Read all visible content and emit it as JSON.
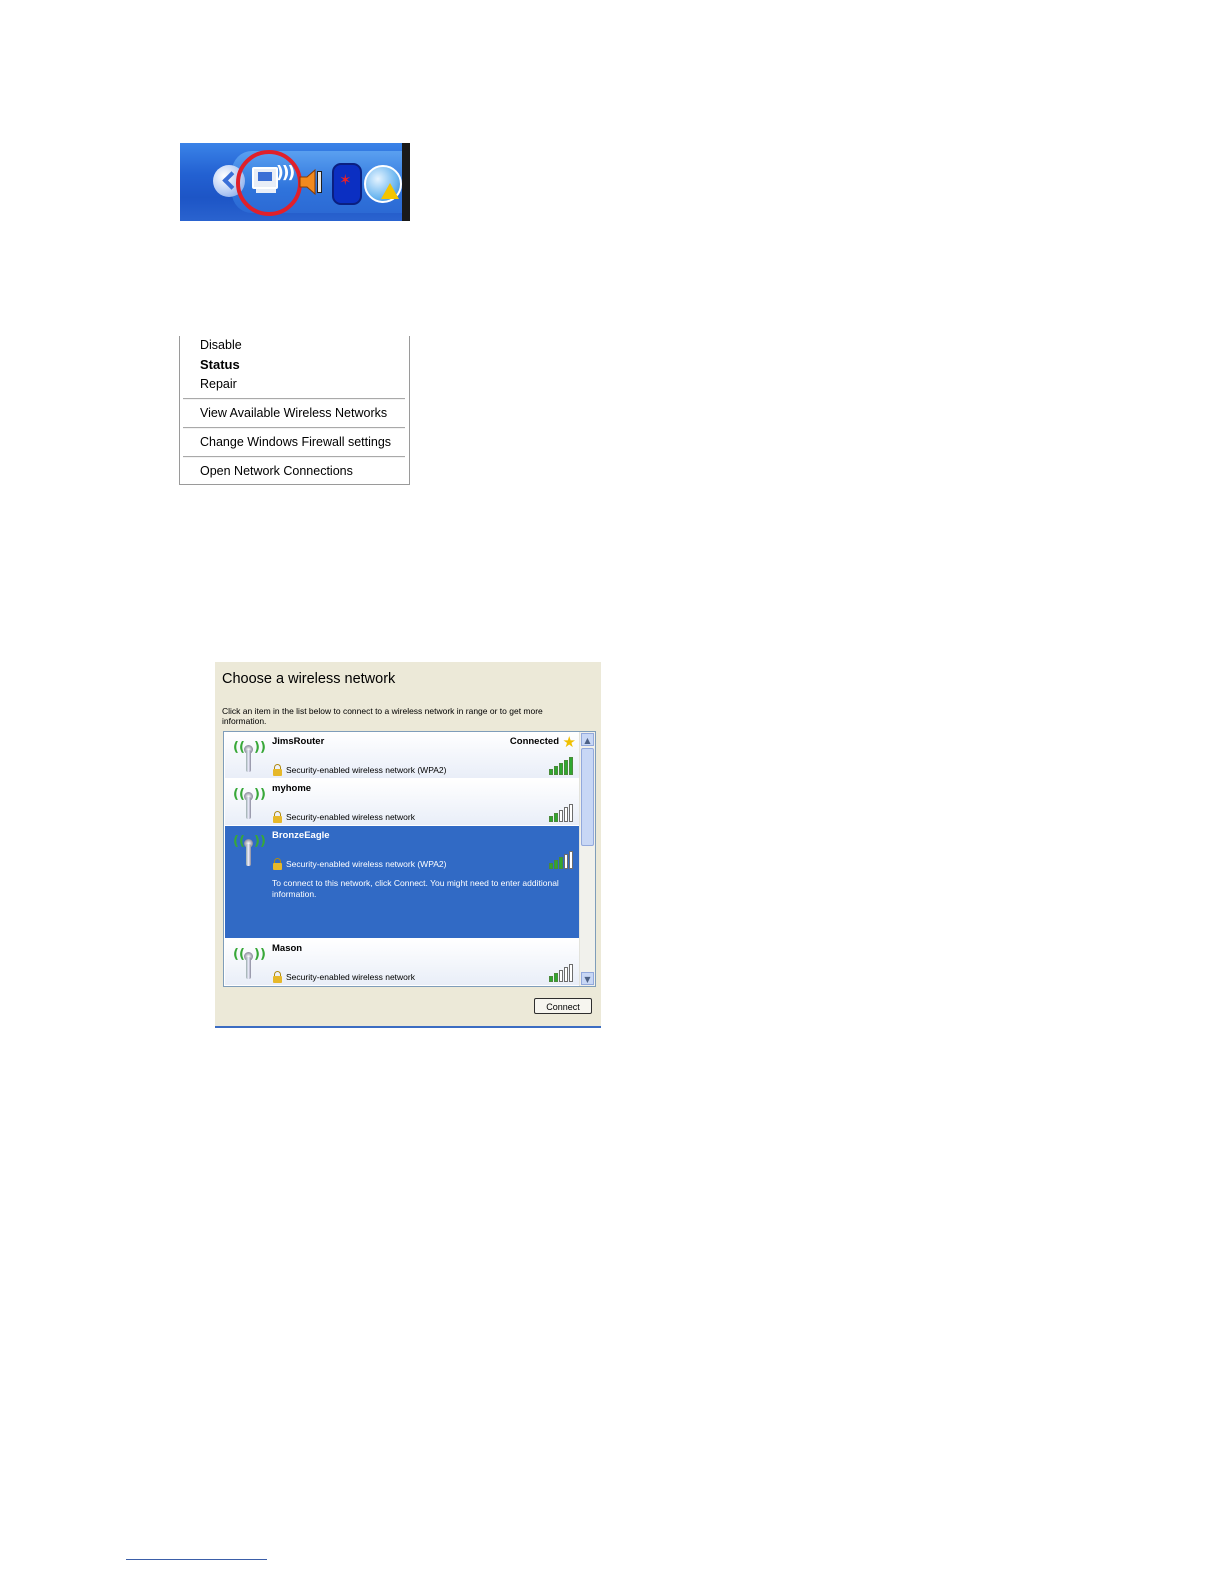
{
  "tray": {
    "icons": [
      "expand-chevron-icon",
      "wireless-network-icon",
      "volume-icon",
      "bluetooth-icon",
      "security-alert-icon"
    ],
    "highlight_color": "#e0202a"
  },
  "context_menu": {
    "items": [
      {
        "label": "Disable"
      },
      {
        "label": "Status",
        "bold": true
      },
      {
        "label": "Repair"
      },
      {
        "label": "View Available Wireless Networks"
      },
      {
        "label": "Change Windows Firewall settings"
      },
      {
        "label": "Open Network Connections"
      }
    ]
  },
  "wireless_dialog": {
    "title": "Choose a wireless network",
    "description": "Click an item in the list below to connect to a wireless network in range or to get more information.",
    "networks": [
      {
        "name": "JimsRouter",
        "security": "Security-enabled wireless network (WPA2)",
        "status": "Connected",
        "signal_bars": 5
      },
      {
        "name": "myhome",
        "security": "Security-enabled wireless network",
        "signal_bars": 2
      },
      {
        "name": "BronzeEagle",
        "security": "Security-enabled wireless network (WPA2)",
        "info": "To connect to this network, click Connect. You might need to enter additional information.",
        "selected": true,
        "signal_bars": 3
      },
      {
        "name": "Mason",
        "security": "Security-enabled wireless network",
        "signal_bars": 2
      }
    ],
    "connect_label": "Connect",
    "selection_color": "#316ac5"
  }
}
